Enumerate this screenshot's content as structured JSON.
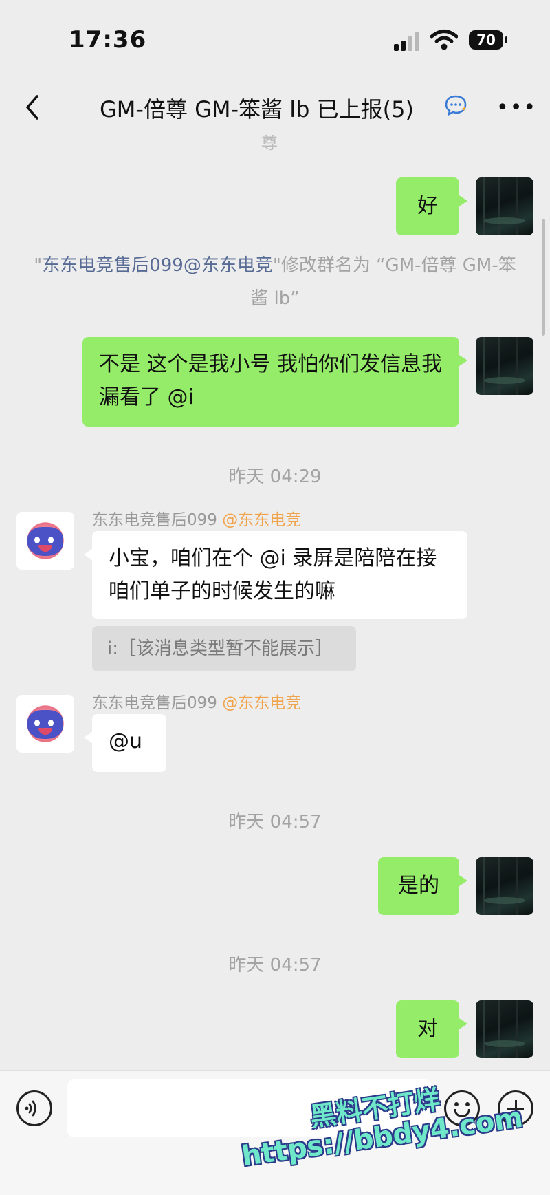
{
  "status_bar": {
    "time": "17:36",
    "battery": "70"
  },
  "nav": {
    "title": "GM-倍尊 GM-笨酱 lb 已上报(5)"
  },
  "cut_text": "尊",
  "messages": {
    "m1": {
      "text": "好"
    },
    "system_note": {
      "quote_open": "\"",
      "name": "东东电竞售后099@东东电竞",
      "rest": "\"修改群名为 “GM-倍尊 GM-笨酱 lb”"
    },
    "m2": {
      "text": "不是 这个是我小号 我怕你们发信息我漏看了 @i"
    },
    "time1": "昨天 04:29",
    "m3": {
      "sender": "东东电竞售后099",
      "mention": "@东东电竞",
      "text": "小宝，咱们在个 @i 录屏是陪陪在接咱们单子的时候发生的嘛",
      "quote": "i:［该消息类型暂不能展示］"
    },
    "m4": {
      "sender": "东东电竞售后099",
      "mention": "@东东电竞",
      "text": "@u"
    },
    "time2": "昨天 04:57",
    "m5": {
      "text": "是的"
    },
    "time3": "昨天 04:57",
    "m6": {
      "text": "对"
    }
  },
  "watermark": {
    "line1": "黑料不打烊",
    "line2": "https://bbdy4.com"
  }
}
